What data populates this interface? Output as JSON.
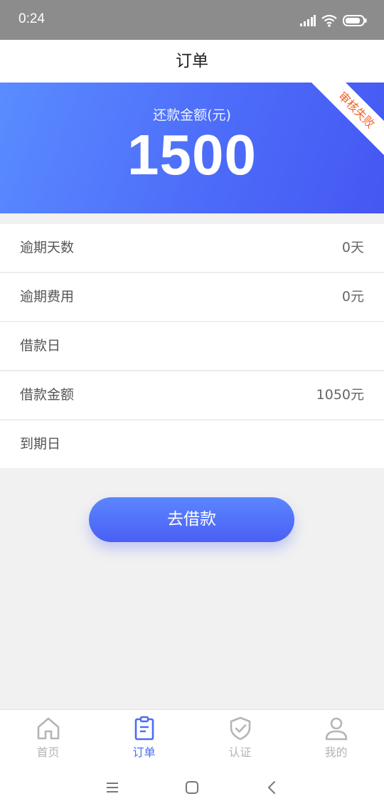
{
  "status_bar": {
    "time": "0:24"
  },
  "header": {
    "title": "订单"
  },
  "hero": {
    "label": "还款金额(元)",
    "amount": "1500",
    "badge": "审核失败",
    "gradient_colors": [
      "#5a8cff",
      "#4557f2"
    ],
    "badge_color": "#f2612c"
  },
  "overdue": [
    {
      "label": "逾期天数",
      "value": "0天"
    },
    {
      "label": "逾期费用",
      "value": "0元"
    }
  ],
  "loan": [
    {
      "label": "借款日",
      "value": ""
    },
    {
      "label": "借款金额",
      "value": "1050元"
    },
    {
      "label": "到期日",
      "value": ""
    }
  ],
  "action": {
    "label": "去借款"
  },
  "tabbar": {
    "active_color": "#4a6cf7",
    "inactive_color": "#b5b5b5",
    "items": [
      {
        "label": "首页",
        "icon": "home-icon",
        "active": false
      },
      {
        "label": "订单",
        "icon": "order-clipboard-icon",
        "active": true
      },
      {
        "label": "认证",
        "icon": "shield-check-icon",
        "active": false
      },
      {
        "label": "我的",
        "icon": "user-icon",
        "active": false
      }
    ]
  },
  "system_nav": {
    "icons": [
      "menu-icon",
      "home-square-icon",
      "back-icon"
    ]
  }
}
